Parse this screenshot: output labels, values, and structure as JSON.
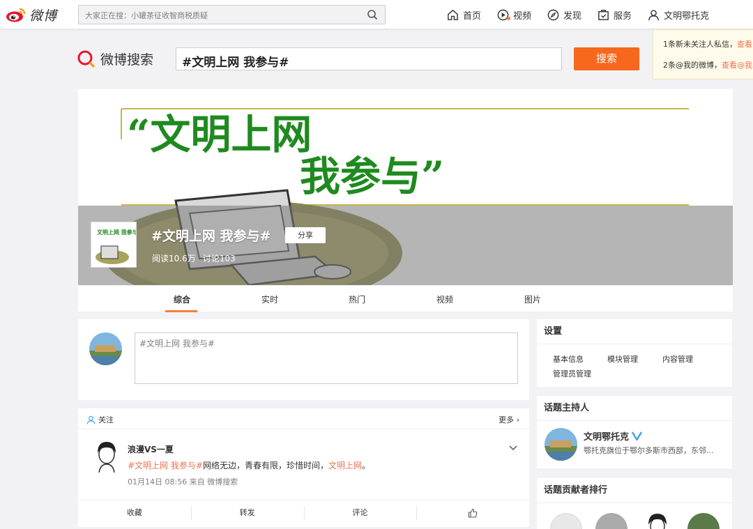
{
  "topnav": {
    "logo_text": "微博",
    "search_placeholder": "大家正在搜：小罐茶征收智商税质疑",
    "items": [
      {
        "label": "首页",
        "icon": "home-icon"
      },
      {
        "label": "视频",
        "icon": "video-icon"
      },
      {
        "label": "发现",
        "icon": "discover-icon"
      },
      {
        "label": "服务",
        "icon": "service-icon"
      },
      {
        "label": "文明鄂托克",
        "icon": "user-icon"
      }
    ]
  },
  "notice": {
    "row1_text": "1条新未关注人私信，",
    "row1_link": "查看",
    "row2_text": "2条@我的微博，",
    "row2_link": "查看@我"
  },
  "search": {
    "logo_text": "微博搜索",
    "query": "#文明上网 我参与#",
    "button": "搜索"
  },
  "topic": {
    "banner_line1": "“文明上网",
    "banner_line2": "我参与”",
    "thumb_text": "文明上网 我参与",
    "title": "#文明上网 我参与#",
    "share": "分享",
    "reads": "阅读10.6万",
    "discussions": "讨论103"
  },
  "tabs": [
    "综合",
    "实时",
    "热门",
    "视频",
    "图片"
  ],
  "composer": {
    "placeholder": "#文明上网 我参与#"
  },
  "feed": {
    "follow_label": "关注",
    "more_label": "更多",
    "post": {
      "author": "浪漫VS一夏",
      "tag": "#文明上网 我参与#",
      "text": "网络无边，青春有限，珍惜时间，",
      "link": "文明上网",
      "end": "。",
      "meta": "01月14日 08:56 来自 微博搜索"
    },
    "actions": [
      "收藏",
      "转发",
      "评论"
    ]
  },
  "sidebar": {
    "settings": {
      "title": "设置",
      "links": [
        "基本信息",
        "模块管理",
        "内容管理",
        "管理员管理"
      ]
    },
    "host": {
      "title": "话题主持人",
      "name": "文明鄂托克",
      "desc": "鄂托克旗位于鄂尔多斯市西部，东邻..."
    },
    "contributors": {
      "title": "话题贡献者排行"
    }
  },
  "colors": {
    "accent": "#f7671d",
    "link": "#eb7350",
    "banner_green": "#1f8a1f",
    "verified": "#4aa6e8"
  }
}
